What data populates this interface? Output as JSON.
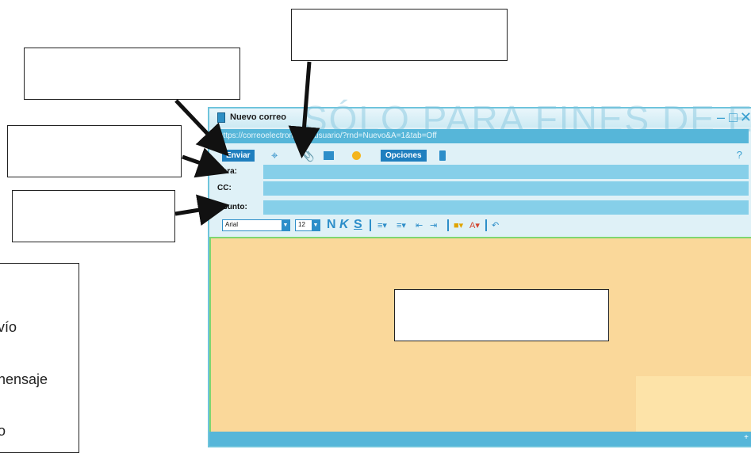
{
  "legend": {
    "line1": "vío",
    "line2": "nensaje",
    "line3": "o"
  },
  "window": {
    "title": "Nuevo correo",
    "url": "https://correoelectronico.miusuario/?rnd=Nuevo&A=1&tab=Off",
    "watermark": "SÓLO PARA FINES DE EVALUACIÓN",
    "controls": {
      "minimize": "–",
      "maximize": "□",
      "close": "✕"
    }
  },
  "toolbar": {
    "send_label": "Enviar",
    "options_label": "Opciones",
    "help_label": "?"
  },
  "fields": {
    "para_label": "Para:",
    "cc_label": "CC:",
    "asunto_label": "Asunto:",
    "para_value": "",
    "cc_value": "",
    "asunto_value": ""
  },
  "format": {
    "font": "Arial",
    "size": "12",
    "bold": "N",
    "italic": "K",
    "underline": "S"
  },
  "colors": {
    "accent": "#2d8ec9",
    "body_bg": "#fad89a",
    "field_bg": "#86cfe9"
  }
}
